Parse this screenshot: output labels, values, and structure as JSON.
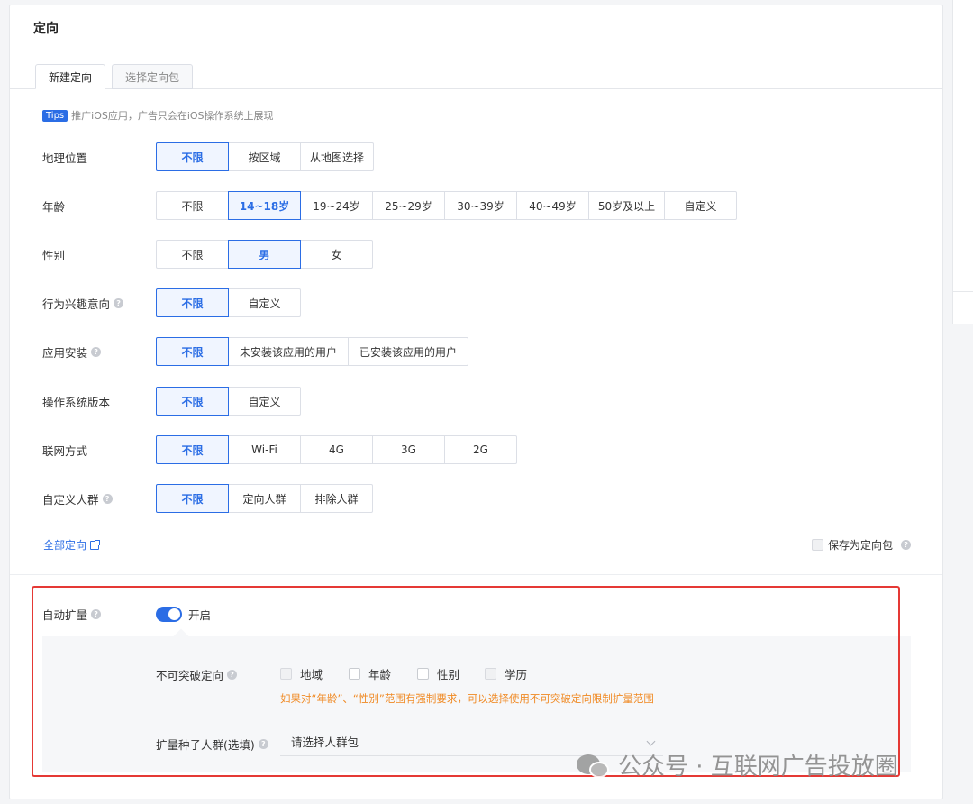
{
  "header": {
    "title": "定向"
  },
  "tabs": [
    {
      "label": "新建定向",
      "active": true
    },
    {
      "label": "选择定向包",
      "active": false
    }
  ],
  "tips": {
    "badge": "Tips",
    "text": "推广iOS应用，广告只会在iOS操作系统上展现"
  },
  "rows": {
    "geo": {
      "label": "地理位置",
      "options": [
        "不限",
        "按区域",
        "从地图选择"
      ],
      "selected": "不限"
    },
    "age": {
      "label": "年龄",
      "options": [
        "不限",
        "14~18岁",
        "19~24岁",
        "25~29岁",
        "30~39岁",
        "40~49岁",
        "50岁及以上",
        "自定义"
      ],
      "selected": "14~18岁"
    },
    "gender": {
      "label": "性别",
      "options": [
        "不限",
        "男",
        "女"
      ],
      "selected": "男"
    },
    "interest": {
      "label": "行为兴趣意向",
      "options": [
        "不限",
        "自定义"
      ],
      "selected": "不限"
    },
    "app_install": {
      "label": "应用安装",
      "options": [
        "不限",
        "未安装该应用的用户",
        "已安装该应用的用户"
      ],
      "selected": "不限"
    },
    "os_version": {
      "label": "操作系统版本",
      "options": [
        "不限",
        "自定义"
      ],
      "selected": "不限"
    },
    "network": {
      "label": "联网方式",
      "options": [
        "不限",
        "Wi-Fi",
        "4G",
        "3G",
        "2G"
      ],
      "selected": "不限"
    },
    "custom_audience": {
      "label": "自定义人群",
      "options": [
        "不限",
        "定向人群",
        "排除人群"
      ],
      "selected": "不限"
    }
  },
  "all_targeting_link": "全部定向",
  "save_as_package": "保存为定向包",
  "auto_expand": {
    "label": "自动扩量",
    "toggle_on": true,
    "toggle_label": "开启",
    "unbreakable_label": "不可突破定向",
    "unbreakable_options": [
      "地域",
      "年龄",
      "性别",
      "学历"
    ],
    "warning": "如果对“年龄”、“性别”范围有强制要求，可以选择使用不可突破定向限制扩量范围",
    "seed_label": "扩量种子人群(选填)",
    "seed_placeholder": "请选择人群包"
  },
  "watermark": {
    "text": "公众号 · 互联网广告投放圈"
  },
  "colors": {
    "accent": "#2b6de5",
    "warning": "#f08a24",
    "highlight_box": "#e53935"
  }
}
